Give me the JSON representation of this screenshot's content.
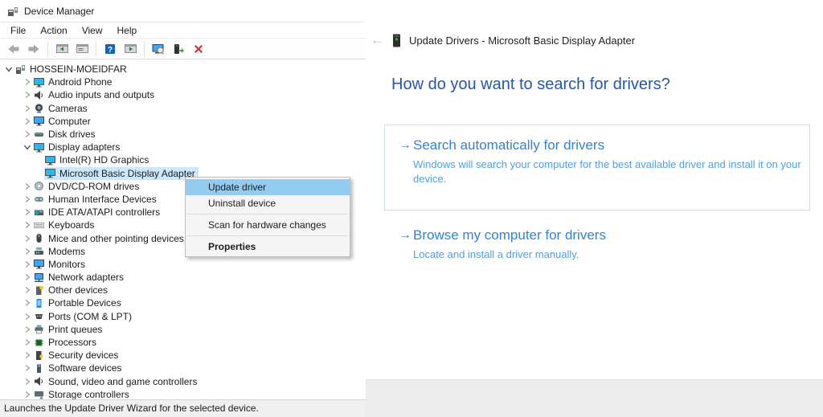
{
  "left_window": {
    "title": "Device Manager",
    "menubar": {
      "items": [
        "File",
        "Action",
        "View",
        "Help"
      ]
    },
    "toolbar": {
      "icons": [
        "back-arrow-icon",
        "forward-arrow-icon",
        "sep",
        "show-tree-icon",
        "properties-window-icon",
        "sep",
        "help-icon",
        "action-pane-icon",
        "sep",
        "scan-monitor-icon",
        "update-driver-icon",
        "uninstall-icon"
      ]
    },
    "status": "Launches the Update Driver Wizard for the selected device.",
    "tree": {
      "items": [
        {
          "label": "HOSSEIN-MOEIDFAR",
          "icon": "computer-icon",
          "level": 0,
          "state": "expanded"
        },
        {
          "label": "Android Phone",
          "icon": "display-adapter-icon",
          "level": 1,
          "state": "collapsed"
        },
        {
          "label": "Audio inputs and outputs",
          "icon": "speaker-icon",
          "level": 1,
          "state": "collapsed"
        },
        {
          "label": "Cameras",
          "icon": "camera-icon",
          "level": 1,
          "state": "collapsed"
        },
        {
          "label": "Computer",
          "icon": "monitor-icon",
          "level": 1,
          "state": "collapsed"
        },
        {
          "label": "Disk drives",
          "icon": "disk-icon",
          "level": 1,
          "state": "collapsed"
        },
        {
          "label": "Display adapters",
          "icon": "display-adapter-icon",
          "level": 1,
          "state": "expanded"
        },
        {
          "label": "Intel(R) HD Graphics",
          "icon": "display-adapter-icon",
          "level": 2,
          "state": "none"
        },
        {
          "label": "Microsoft Basic Display Adapter",
          "icon": "display-adapter-icon",
          "level": 2,
          "state": "none",
          "selected": true
        },
        {
          "label": "DVD/CD-ROM drives",
          "icon": "dvd-icon",
          "level": 1,
          "state": "collapsed"
        },
        {
          "label": "Human Interface Devices",
          "icon": "hid-icon",
          "level": 1,
          "state": "collapsed"
        },
        {
          "label": "IDE ATA/ATAPI controllers",
          "icon": "ide-icon",
          "level": 1,
          "state": "collapsed"
        },
        {
          "label": "Keyboards",
          "icon": "keyboard-icon",
          "level": 1,
          "state": "collapsed"
        },
        {
          "label": "Mice and other pointing devices",
          "icon": "mouse-icon",
          "level": 1,
          "state": "collapsed"
        },
        {
          "label": "Modems",
          "icon": "modem-icon",
          "level": 1,
          "state": "collapsed"
        },
        {
          "label": "Monitors",
          "icon": "monitor-icon",
          "level": 1,
          "state": "collapsed"
        },
        {
          "label": "Network adapters",
          "icon": "network-icon",
          "level": 1,
          "state": "collapsed"
        },
        {
          "label": "Other devices",
          "icon": "other-device-icon",
          "level": 1,
          "state": "collapsed"
        },
        {
          "label": "Portable Devices",
          "icon": "portable-icon",
          "level": 1,
          "state": "collapsed"
        },
        {
          "label": "Ports (COM & LPT)",
          "icon": "ports-icon",
          "level": 1,
          "state": "collapsed"
        },
        {
          "label": "Print queues",
          "icon": "printer-icon",
          "level": 1,
          "state": "collapsed"
        },
        {
          "label": "Processors",
          "icon": "processor-icon",
          "level": 1,
          "state": "collapsed"
        },
        {
          "label": "Security devices",
          "icon": "security-icon",
          "level": 1,
          "state": "collapsed"
        },
        {
          "label": "Software devices",
          "icon": "software-icon",
          "level": 1,
          "state": "collapsed"
        },
        {
          "label": "Sound, video and game controllers",
          "icon": "speaker-icon",
          "level": 1,
          "state": "collapsed"
        },
        {
          "label": "Storage controllers",
          "icon": "storage-icon",
          "level": 1,
          "state": "collapsed"
        }
      ]
    }
  },
  "context_menu": {
    "items": [
      {
        "label": "Update driver",
        "highlighted": true
      },
      {
        "label": "Uninstall device"
      },
      {
        "separator": true
      },
      {
        "label": "Scan for hardware changes"
      },
      {
        "separator": true
      },
      {
        "label": "Properties",
        "bold": true
      }
    ]
  },
  "wizard": {
    "back_label": "←",
    "title": "Update Drivers - Microsoft Basic Display Adapter",
    "heading": "How do you want to search for drivers?",
    "options": [
      {
        "title": "Search automatically for drivers",
        "description": "Windows will search your computer for the best available driver and install it on your device."
      },
      {
        "title": "Browse my computer for drivers",
        "description": "Locate and install a driver manually."
      }
    ]
  },
  "colors": {
    "heading_blue": "#2856a8",
    "option_blue": "#3184d6",
    "description_blue": "#4f9ee4",
    "tree_selection": "#cce8ff",
    "menu_highlight": "#93cbf1"
  }
}
